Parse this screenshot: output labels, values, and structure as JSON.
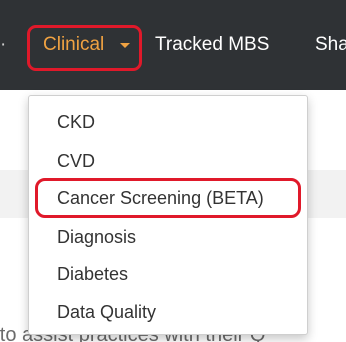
{
  "nav": {
    "separator": "·",
    "clinical_label": "Clinical",
    "tracked_label": "Tracked MBS",
    "share_label": "Sha"
  },
  "dropdown": {
    "items": [
      {
        "label": "CKD"
      },
      {
        "label": "CVD"
      },
      {
        "label": "Cancer Screening (BETA)"
      },
      {
        "label": "Diagnosis"
      },
      {
        "label": "Diabetes"
      },
      {
        "label": "Data Quality"
      }
    ]
  },
  "background_text": "rt to assist practices with their Q",
  "colors": {
    "navbar": "#2f3235",
    "active_nav": "#f0a242",
    "highlight": "#e0192a"
  }
}
